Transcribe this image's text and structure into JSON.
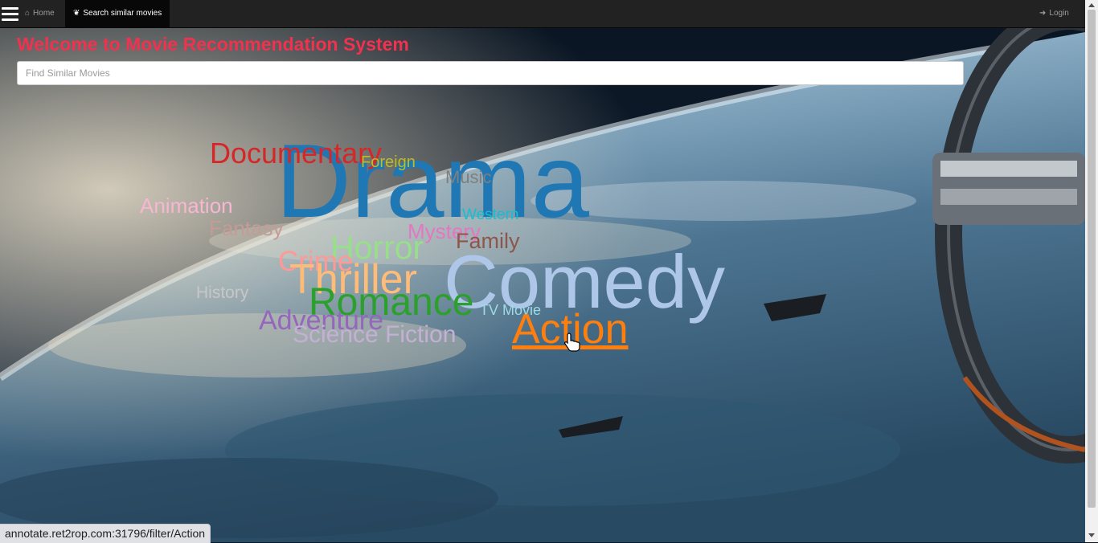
{
  "navbar": {
    "home_label": "Home",
    "search_label": "Search similar movies",
    "login_label": "Login"
  },
  "page": {
    "title": "Welcome to Movie Recommendation System",
    "search_placeholder": "Find Similar Movies"
  },
  "word_cloud": [
    {
      "label": "Drama",
      "color": "#1f77b4"
    },
    {
      "label": "Documentary",
      "color": "#d62728"
    },
    {
      "label": "Foreign",
      "color": "#bcbd22"
    },
    {
      "label": "Music",
      "color": "#7f7f7f"
    },
    {
      "label": "Animation",
      "color": "#f7b6d2"
    },
    {
      "label": "Western",
      "color": "#17becf"
    },
    {
      "label": "Fantasy",
      "color": "#c49c94"
    },
    {
      "label": "Mystery",
      "color": "#e377c2"
    },
    {
      "label": "Family",
      "color": "#8c564b"
    },
    {
      "label": "Horror",
      "color": "#98df8a"
    },
    {
      "label": "Crime",
      "color": "#ff9896"
    },
    {
      "label": "Thriller",
      "color": "#ffbb78"
    },
    {
      "label": "Comedy",
      "color": "#aec7e8"
    },
    {
      "label": "History",
      "color": "#c7c7c7"
    },
    {
      "label": "Romance",
      "color": "#2ca02c"
    },
    {
      "label": "TV Movie",
      "color": "#9edae5"
    },
    {
      "label": "Adventure",
      "color": "#9467bd"
    },
    {
      "label": "Science Fiction",
      "color": "#c5b0d5"
    },
    {
      "label": "Action",
      "color": "#ff7f0e"
    }
  ],
  "status_bar": {
    "url": "annotate.ret2rop.com:31796/filter/Action"
  }
}
